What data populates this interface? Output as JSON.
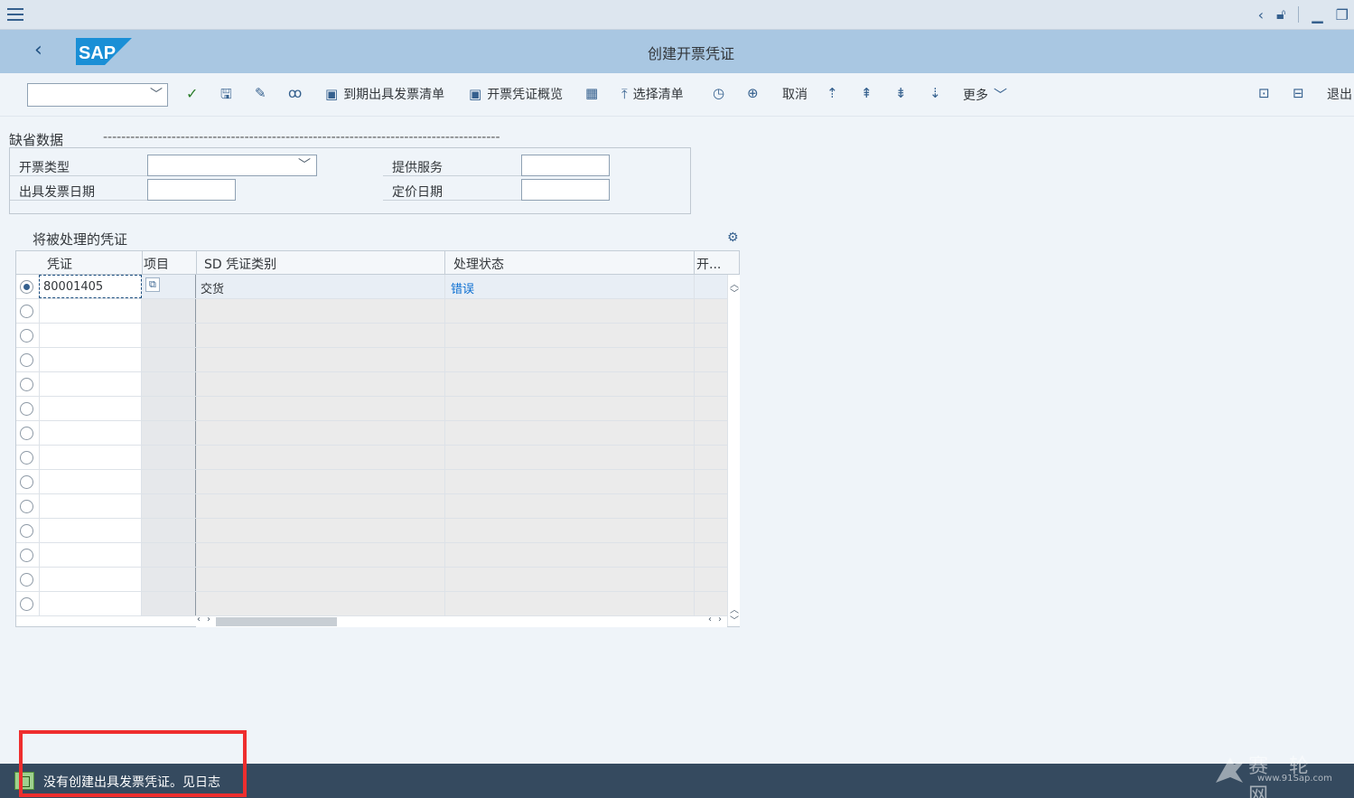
{
  "window": {
    "title": "创建开票凭证",
    "logo_text": "SAP"
  },
  "toolbar": {
    "items": [
      {
        "icon": "check-icon",
        "label": ""
      },
      {
        "icon": "save-icon",
        "label": ""
      },
      {
        "icon": "pencil-icon",
        "label": ""
      },
      {
        "icon": "glasses-icon",
        "label": ""
      },
      {
        "icon": "image-icon",
        "label": "到期出具发票清单"
      },
      {
        "icon": "image-icon",
        "label": "开票凭证概览"
      },
      {
        "icon": "calendar-icon",
        "label": ""
      },
      {
        "icon": "upload-icon",
        "label": "选择清单"
      },
      {
        "icon": "history-icon",
        "label": ""
      },
      {
        "icon": "plus-circle-icon",
        "label": ""
      },
      {
        "icon": "",
        "label": "取消"
      },
      {
        "icon": "doc-up-icon",
        "label": ""
      },
      {
        "icon": "doc-up2-icon",
        "label": ""
      },
      {
        "icon": "doc-down-icon",
        "label": ""
      },
      {
        "icon": "doc-down2-icon",
        "label": ""
      },
      {
        "icon": "chevron-down-icon",
        "label": "更多"
      }
    ],
    "exit_label": "退出"
  },
  "defaults": {
    "title": "缺省数据",
    "dashes": "---------------------------------------------------------------------------------------",
    "billing_type_label": "开票类型",
    "billing_type_value": "",
    "invoice_date_label": "出具发票日期",
    "invoice_date_value": "",
    "service_label": "提供服务",
    "service_value": "",
    "pricing_date_label": "定价日期",
    "pricing_date_value": ""
  },
  "docs": {
    "title": "将被处理的凭证",
    "columns": [
      "凭证",
      "项目",
      "SD 凭证类别",
      "处理状态",
      "开..."
    ],
    "rows": [
      {
        "doc": "80001405",
        "item": "",
        "category": "交货",
        "status": "错误",
        "selected": true
      }
    ]
  },
  "status": {
    "message": "没有创建出具发票凭证。见日志"
  },
  "watermark": {
    "line1": "赛 轮 网",
    "line2": "www.91Sap.com"
  }
}
